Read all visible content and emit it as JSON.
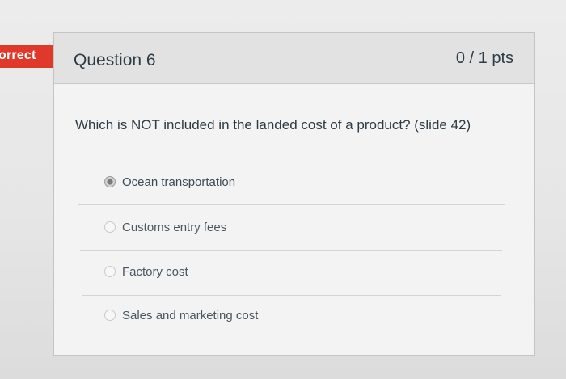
{
  "result_flag": {
    "label": "orrect",
    "color": "#e0382a"
  },
  "question": {
    "title": "Question 6",
    "points": "0 / 1 pts",
    "text": "Which is NOT included in the landed cost of a product? (slide 42)"
  },
  "answers": [
    {
      "label": "Ocean transportation",
      "selected": true
    },
    {
      "label": "Customs entry fees",
      "selected": false
    },
    {
      "label": "Factory cost",
      "selected": false
    },
    {
      "label": "Sales and marketing cost",
      "selected": false
    }
  ],
  "colors": {
    "text": "#2d3b45",
    "header_bg": "#e2e2e2",
    "card_bg": "#f3f3f3"
  }
}
